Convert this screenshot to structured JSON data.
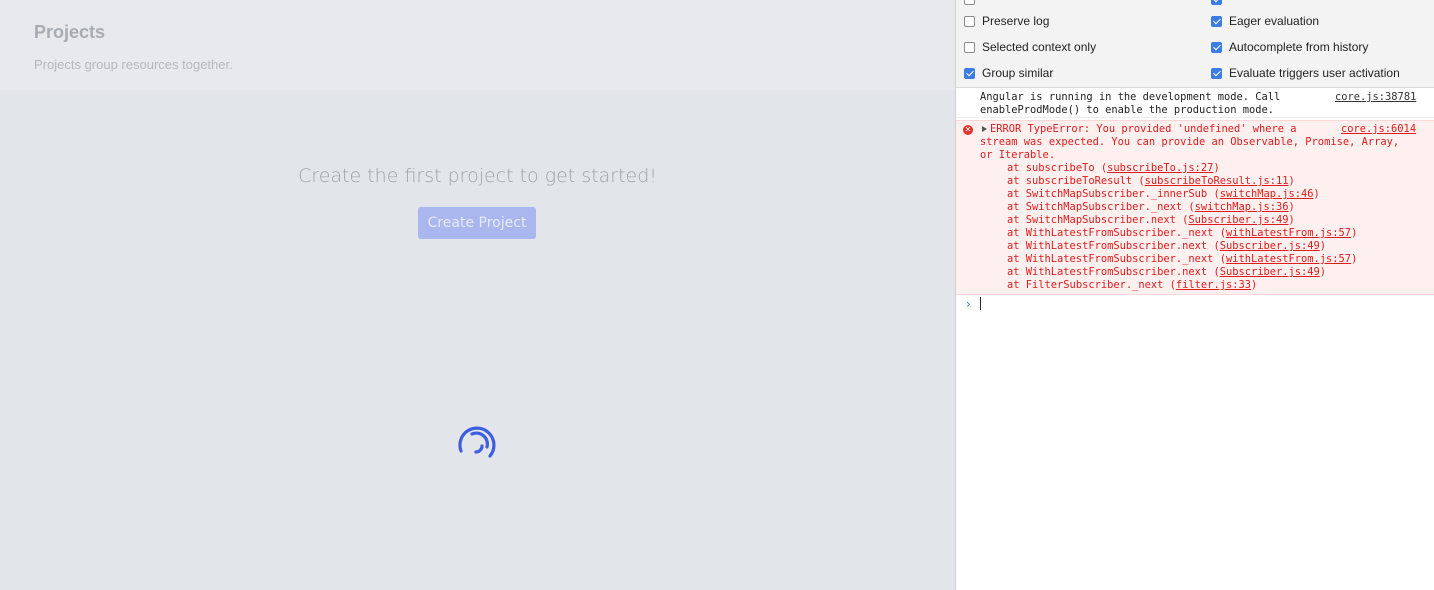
{
  "app": {
    "title": "Projects",
    "subtitle": "Projects group resources together.",
    "empty_message": "Create the first project to get started!",
    "create_button": "Create Project",
    "accent": "#3d5ee0"
  },
  "devtools": {
    "settings": {
      "left": [
        {
          "label": "Preserve log",
          "checked": false
        },
        {
          "label": "Selected context only",
          "checked": false
        },
        {
          "label": "Group similar",
          "checked": true
        }
      ],
      "right": [
        {
          "label": "Eager evaluation",
          "checked": true
        },
        {
          "label": "Autocomplete from history",
          "checked": true
        },
        {
          "label": "Evaluate triggers user activation",
          "checked": true
        }
      ]
    },
    "info_message": {
      "text": "Angular is running in the development mode. Call\nenableProdMode() to enable the production mode.",
      "source": "core.js:38781"
    },
    "error_message": {
      "icon": "error-icon",
      "lines": [
        "ERROR TypeError: You provided 'undefined' where a",
        "stream was expected. You can provide an Observable, Promise, Array,",
        "or Iterable."
      ],
      "source": "core.js:6014",
      "stack": [
        {
          "fn": "at subscribeTo (",
          "file": "subscribeTo.js:27",
          "end": ")"
        },
        {
          "fn": "at subscribeToResult (",
          "file": "subscribeToResult.js:11",
          "end": ")"
        },
        {
          "fn": "at SwitchMapSubscriber._innerSub (",
          "file": "switchMap.js:46",
          "end": ")"
        },
        {
          "fn": "at SwitchMapSubscriber._next (",
          "file": "switchMap.js:36",
          "end": ")"
        },
        {
          "fn": "at SwitchMapSubscriber.next (",
          "file": "Subscriber.js:49",
          "end": ")"
        },
        {
          "fn": "at WithLatestFromSubscriber._next (",
          "file": "withLatestFrom.js:57",
          "end": ")"
        },
        {
          "fn": "at WithLatestFromSubscriber.next (",
          "file": "Subscriber.js:49",
          "end": ")"
        },
        {
          "fn": "at WithLatestFromSubscriber._next (",
          "file": "withLatestFrom.js:57",
          "end": ")"
        },
        {
          "fn": "at WithLatestFromSubscriber.next (",
          "file": "Subscriber.js:49",
          "end": ")"
        },
        {
          "fn": "at FilterSubscriber._next (",
          "file": "filter.js:33",
          "end": ")"
        }
      ]
    },
    "prompt_symbol": "›"
  }
}
